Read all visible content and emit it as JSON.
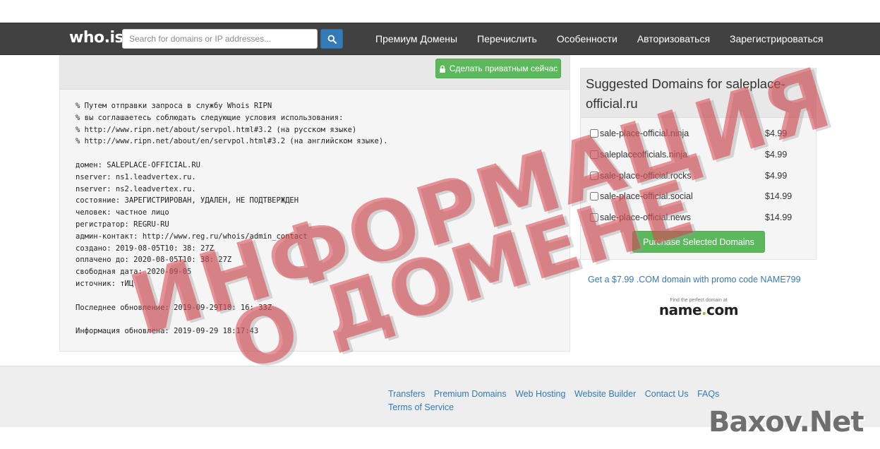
{
  "header": {
    "logo": "who.is",
    "search_placeholder": "Search for domains or IP addresses...",
    "nav": [
      "Премиум Домены",
      "Перечислить",
      "Особенности",
      "Авторизоваться",
      "Зарегистрироваться"
    ]
  },
  "whois": {
    "private_button": "Сделать приватным сейчас",
    "lines": [
      "% Путем отправки запроса в службу Whois RIPN",
      "% вы соглашаетесь соблюдать следующие условия использования:",
      "% http://www.ripn.net/about/servpol.html#3.2 (на русском языке)",
      "% http://www.ripn.net/about/en/servpol.html#3.2 (на английском языке).",
      "",
      "домен: SALEPLACE-OFFICIAL.RU",
      "nserver: ns1.leadvertex.ru.",
      "nserver: ns2.leadvertex.ru.",
      "состояние: ЗАРЕГИСТРИРОВАН, УДАЛЕН, НЕ ПОДТВЕРЖДЕН",
      "человек: частное лицо",
      "регистратор: REGRU-RU",
      "админ-контакт: http://www.reg.ru/whois/admin_contact",
      "создано: 2019-08-05T10: 38: 27Z",
      "оплачено до: 2020-08-05T10: 38: 27Z",
      "свободная дата: 2020-09-05",
      "источник: тИЦ",
      "",
      "Последнее обновление: 2019-09-29T18: 16: 33Z",
      "",
      "Информация обновлена: 2019-09-29 18:17:43"
    ]
  },
  "suggested": {
    "title": "Suggested Domains for saleplace-official.ru",
    "domains": [
      {
        "name": "sale-place-official.ninja",
        "price": "$4.99"
      },
      {
        "name": "saleplaceofficials.ninja",
        "price": "$4.99"
      },
      {
        "name": "sale-place-official.rocks",
        "price": "$4.99"
      },
      {
        "name": "sale-place-official.social",
        "price": "$14.99"
      },
      {
        "name": "sale-place-official.news",
        "price": "$14.99"
      }
    ],
    "purchase_button": "Purchase Selected Domains"
  },
  "promo": {
    "text": "Get a $7.99 .COM domain with promo code NAME799",
    "tagline": "Find the perfect domain at",
    "logo_main": "name",
    "logo_dot": ".",
    "logo_tld": "com"
  },
  "footer": {
    "links": [
      "Transfers",
      "Premium Domains",
      "Web Hosting",
      "Website Builder",
      "Contact Us",
      "FAQs",
      "Terms of Service"
    ]
  },
  "overlay": {
    "line1": "ИНФОРМАЦИЯ",
    "line2": "О ДОМЕНЕ",
    "watermark": "Baxov.Net"
  },
  "colors": {
    "navbar": "#414141",
    "primary": "#337ab7",
    "success": "#5cb85c",
    "stamp": "#d93e46"
  }
}
